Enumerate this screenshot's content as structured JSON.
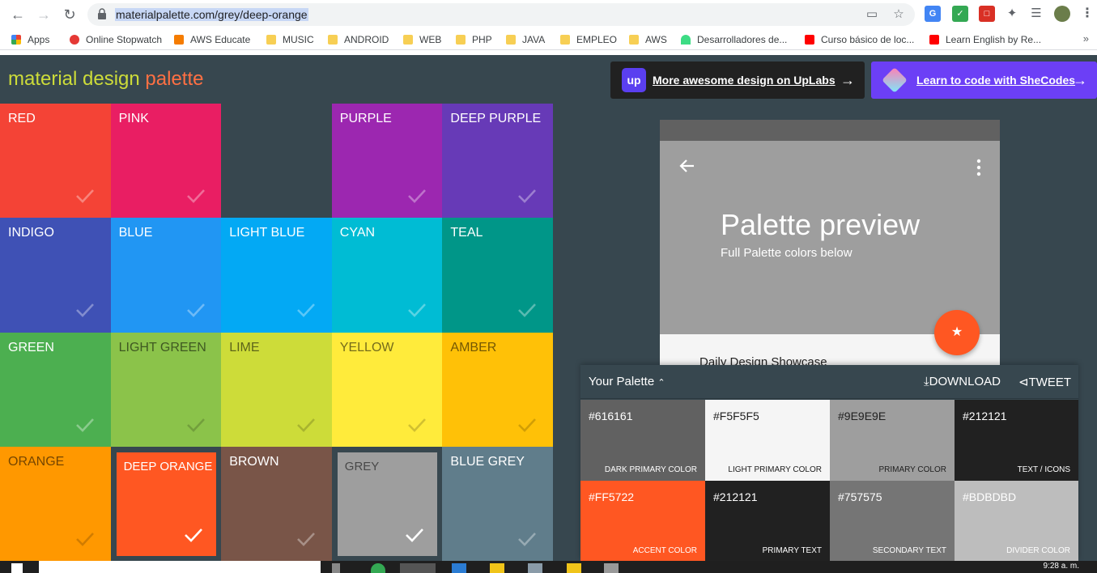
{
  "browser": {
    "url": "materialpalette.com/grey/deep-orange",
    "bookmarks": [
      {
        "label": "Apps",
        "icon": "apps-grid-icon"
      },
      {
        "label": "Online Stopwatch",
        "icon": "stopwatch-icon"
      },
      {
        "label": "AWS Educate",
        "icon": "aws-educate-icon"
      },
      {
        "label": "MUSIC",
        "icon": "folder-icon"
      },
      {
        "label": "ANDROID",
        "icon": "folder-icon"
      },
      {
        "label": "WEB",
        "icon": "folder-icon"
      },
      {
        "label": "PHP",
        "icon": "folder-icon"
      },
      {
        "label": "JAVA",
        "icon": "folder-icon"
      },
      {
        "label": "EMPLEO",
        "icon": "folder-icon"
      },
      {
        "label": "AWS",
        "icon": "folder-icon"
      },
      {
        "label": "Desarrolladores de...",
        "icon": "android-icon"
      },
      {
        "label": "Curso básico de loc...",
        "icon": "youtube-icon"
      },
      {
        "label": "Learn English by Re...",
        "icon": "youtube-icon"
      }
    ],
    "bookmarks_more": "»"
  },
  "header": {
    "logo_part1": "material design",
    "logo_part2": "palette",
    "ad_uplabs": "More awesome design on UpLabs",
    "ad_shecodes": "Learn to code with SheCodes",
    "colors": {
      "logo_part1": "#cddc39",
      "logo_part2": "#ff7043"
    }
  },
  "grid": [
    {
      "name": "RED",
      "color": "#f44336"
    },
    {
      "name": "PINK",
      "color": "#e91e63"
    },
    {
      "name": "",
      "color": "#37474f"
    },
    {
      "name": "PURPLE",
      "color": "#9c27b0"
    },
    {
      "name": "DEEP PURPLE",
      "color": "#673ab7"
    },
    {
      "name": "INDIGO",
      "color": "#3f51b5"
    },
    {
      "name": "BLUE",
      "color": "#2196f3"
    },
    {
      "name": "LIGHT BLUE",
      "color": "#03a9f4"
    },
    {
      "name": "CYAN",
      "color": "#00bcd4"
    },
    {
      "name": "TEAL",
      "color": "#009688"
    },
    {
      "name": "GREEN",
      "color": "#4caf50"
    },
    {
      "name": "LIGHT GREEN",
      "color": "#8bc34a"
    },
    {
      "name": "LIME",
      "color": "#cddc39"
    },
    {
      "name": "YELLOW",
      "color": "#ffeb3b"
    },
    {
      "name": "AMBER",
      "color": "#ffc107"
    },
    {
      "name": "ORANGE",
      "color": "#ff9800"
    },
    {
      "name": "DEEP ORANGE",
      "color": "#ff5722",
      "selected": true
    },
    {
      "name": "BROWN",
      "color": "#795548"
    },
    {
      "name": "GREY",
      "color": "#9e9e9e",
      "selected": true
    },
    {
      "name": "BLUE GREY",
      "color": "#607d8b"
    }
  ],
  "preview": {
    "title": "Palette preview",
    "subtitle": "Full Palette colors below",
    "showcase": "Daily Design Showcase",
    "fab_icon": "star-icon"
  },
  "palette": {
    "title": "Your Palette",
    "download_label": "DOWNLOAD",
    "tweet_label": "TWEET",
    "swatches": [
      {
        "hex": "#616161",
        "role": "DARK PRIMARY COLOR"
      },
      {
        "hex": "#F5F5F5",
        "role": "LIGHT PRIMARY COLOR"
      },
      {
        "hex": "#9E9E9E",
        "role": "PRIMARY COLOR"
      },
      {
        "hex": "#212121",
        "role": "TEXT / ICONS"
      },
      {
        "hex": "#FF5722",
        "role": "ACCENT COLOR"
      },
      {
        "hex": "#212121",
        "role": "PRIMARY TEXT"
      },
      {
        "hex": "#757575",
        "role": "SECONDARY TEXT"
      },
      {
        "hex": "#BDBDBD",
        "role": "DIVIDER COLOR"
      }
    ]
  },
  "taskbar": {
    "clock": "9:28 a. m."
  }
}
